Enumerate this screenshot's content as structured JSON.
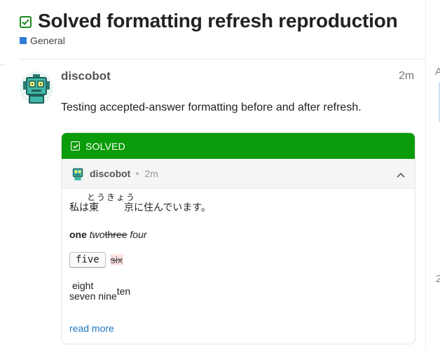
{
  "topic": {
    "title": "Solved formatting refresh reproduction",
    "category": "General",
    "colors": {
      "solved_green": "#0a9c0a",
      "category_blue": "#2f7cd6",
      "link_blue": "#1f76c2"
    }
  },
  "post": {
    "username": "discobot",
    "time": "2m",
    "body": "Testing accepted-answer formatting before and after refresh."
  },
  "solved": {
    "label": "SOLVED",
    "icon": "checkbox-icon",
    "quote": {
      "username": "discobot",
      "time": "2m",
      "collapse_icon": "chevron-up-icon",
      "japanese": {
        "prefix": "私は",
        "kanji1": "東",
        "kanji2": "京",
        "ruby": "とうきょう",
        "suffix": "に住んでいます。"
      },
      "formatted": {
        "bold": "one",
        "italic": "two",
        "strike": "three",
        "italic2": "four"
      },
      "kbd": "five",
      "deleted": "six",
      "annot": {
        "top": "eight",
        "base": "seven nine",
        "sup": "ten"
      },
      "read_more": "read more"
    }
  },
  "edge": {
    "letter_a": "A",
    "digit_2": "2"
  }
}
